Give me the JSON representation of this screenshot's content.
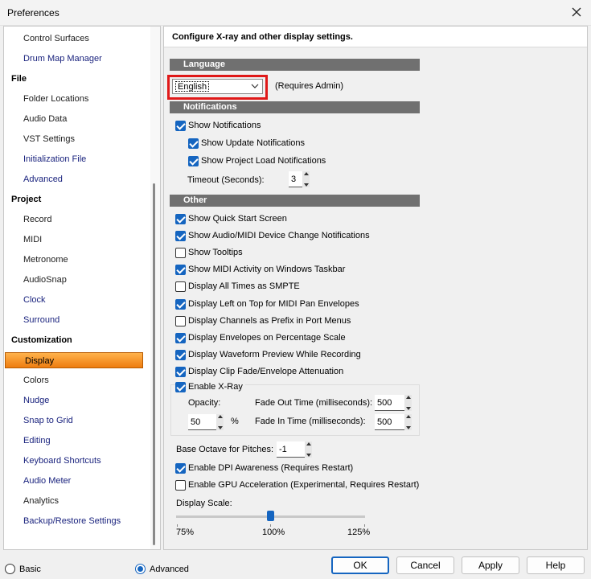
{
  "window": {
    "title": "Preferences"
  },
  "panel": {
    "header": "Configure X-ray and other display settings."
  },
  "nav": {
    "items": [
      {
        "label": "Control Surfaces",
        "kind": "item"
      },
      {
        "label": "Drum Map Manager",
        "kind": "link"
      },
      {
        "label": "File",
        "kind": "cat"
      },
      {
        "label": "Folder Locations",
        "kind": "item"
      },
      {
        "label": "Audio Data",
        "kind": "item"
      },
      {
        "label": "VST Settings",
        "kind": "item"
      },
      {
        "label": "Initialization File",
        "kind": "link"
      },
      {
        "label": "Advanced",
        "kind": "link"
      },
      {
        "label": "Project",
        "kind": "cat"
      },
      {
        "label": "Record",
        "kind": "item"
      },
      {
        "label": "MIDI",
        "kind": "item"
      },
      {
        "label": "Metronome",
        "kind": "item"
      },
      {
        "label": "AudioSnap",
        "kind": "item"
      },
      {
        "label": "Clock",
        "kind": "link"
      },
      {
        "label": "Surround",
        "kind": "link"
      },
      {
        "label": "Customization",
        "kind": "cat"
      },
      {
        "label": "Display",
        "kind": "selected"
      },
      {
        "label": "Colors",
        "kind": "item"
      },
      {
        "label": "Nudge",
        "kind": "link"
      },
      {
        "label": "Snap to Grid",
        "kind": "link"
      },
      {
        "label": "Editing",
        "kind": "link"
      },
      {
        "label": "Keyboard Shortcuts",
        "kind": "link"
      },
      {
        "label": "Audio Meter",
        "kind": "link"
      },
      {
        "label": "Analytics",
        "kind": "item"
      },
      {
        "label": "Backup/Restore Settings",
        "kind": "link"
      }
    ]
  },
  "language": {
    "section": "Language",
    "selected": "English",
    "note": "(Requires Admin)"
  },
  "notifications": {
    "section": "Notifications",
    "show_notifications": {
      "label": "Show Notifications",
      "checked": true
    },
    "show_update": {
      "label": "Show Update Notifications",
      "checked": true
    },
    "show_project_load": {
      "label": "Show Project Load Notifications",
      "checked": true
    },
    "timeout_label": "Timeout (Seconds):",
    "timeout_value": "3"
  },
  "other": {
    "section": "Other",
    "options": [
      {
        "label": "Show Quick Start Screen",
        "checked": true
      },
      {
        "label": "Show Audio/MIDI Device Change Notifications",
        "checked": true
      },
      {
        "label": "Show Tooltips",
        "checked": false
      },
      {
        "label": "Show MIDI Activity on Windows Taskbar",
        "checked": true
      },
      {
        "label": "Display All Times as SMPTE",
        "checked": false
      },
      {
        "label": "Display Left on Top for MIDI Pan Envelopes",
        "checked": true
      },
      {
        "label": "Display Channels as Prefix in Port Menus",
        "checked": false
      },
      {
        "label": "Display Envelopes on Percentage Scale",
        "checked": true
      },
      {
        "label": "Display Waveform Preview While Recording",
        "checked": true
      },
      {
        "label": "Display Clip Fade/Envelope Attenuation",
        "checked": true
      }
    ]
  },
  "xray": {
    "enable_label": "Enable X-Ray",
    "enabled": true,
    "opacity_label": "Opacity:",
    "opacity_value": "50",
    "opacity_unit": "%",
    "fade_out_label": "Fade Out Time (milliseconds):",
    "fade_out_value": "500",
    "fade_in_label": "Fade In Time (milliseconds):",
    "fade_in_value": "500"
  },
  "pitch": {
    "label": "Base Octave for Pitches:",
    "value": "-1"
  },
  "dpi": {
    "label": "Enable DPI Awareness (Requires Restart)",
    "checked": true
  },
  "gpu": {
    "label": "Enable GPU Acceleration (Experimental, Requires Restart)",
    "checked": false
  },
  "scale": {
    "label": "Display Scale:",
    "value_percent": 100,
    "min_label": "75%",
    "mid_label": "100%",
    "max_label": "125%"
  },
  "mode": {
    "basic_label": "Basic",
    "advanced_label": "Advanced",
    "selected": "advanced"
  },
  "buttons": {
    "ok": "OK",
    "cancel": "Cancel",
    "apply": "Apply",
    "help": "Help"
  },
  "colors": {
    "accent": "#1565c0",
    "highlight": "#e01919",
    "selected_nav": "#ee7d10",
    "section_bg": "#707070"
  }
}
